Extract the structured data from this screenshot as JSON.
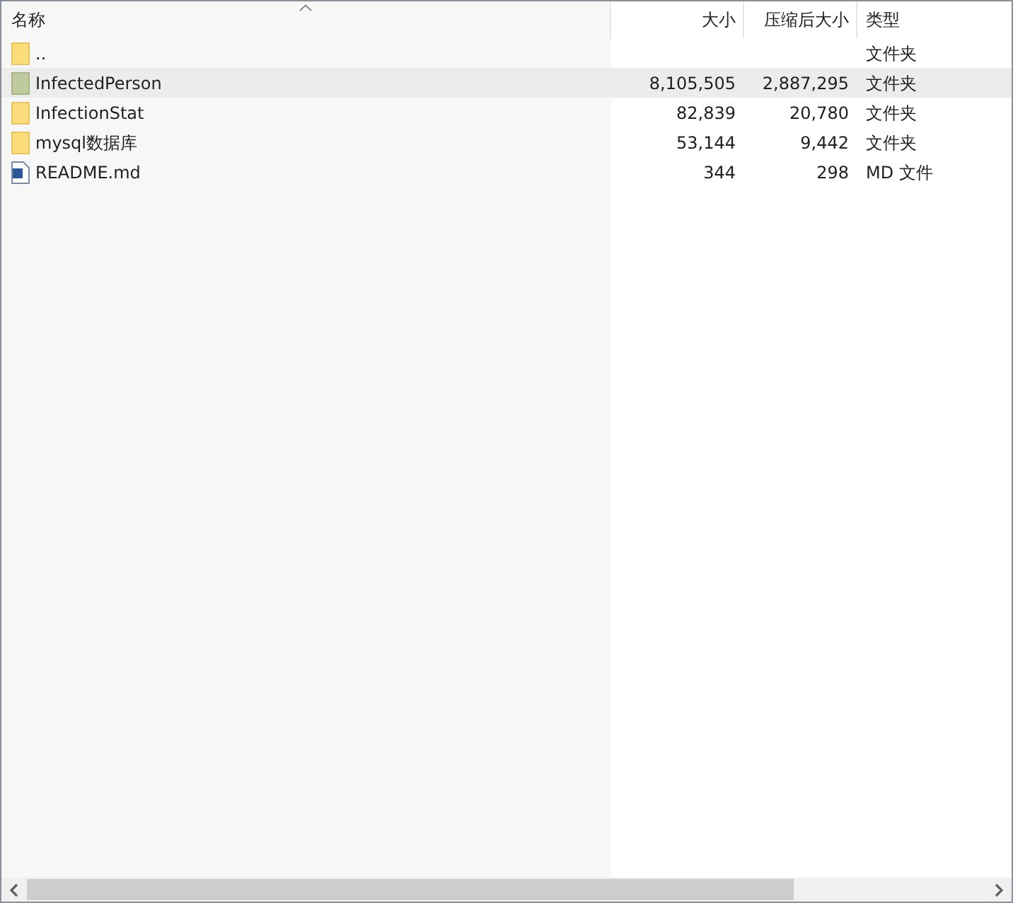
{
  "columns": [
    {
      "label": "名称",
      "sorted": true
    },
    {
      "label": "大小",
      "sorted": false
    },
    {
      "label": "压缩后大小",
      "sorted": false
    },
    {
      "label": "类型",
      "sorted": false
    }
  ],
  "rows": [
    {
      "kind": "folder",
      "name": "..",
      "size": "",
      "packed": "",
      "type": "文件夹",
      "selected": false
    },
    {
      "kind": "folder",
      "name": "InfectedPerson",
      "size": "8,105,505",
      "packed": "2,887,295",
      "type": "文件夹",
      "selected": true
    },
    {
      "kind": "folder",
      "name": "InfectionStat",
      "size": "82,839",
      "packed": "20,780",
      "type": "文件夹",
      "selected": false
    },
    {
      "kind": "folder",
      "name": "mysql数据库",
      "size": "53,144",
      "packed": "9,442",
      "type": "文件夹",
      "selected": false
    },
    {
      "kind": "document",
      "name": "README.md",
      "size": "344",
      "packed": "298",
      "type": "MD 文件",
      "selected": false
    }
  ]
}
